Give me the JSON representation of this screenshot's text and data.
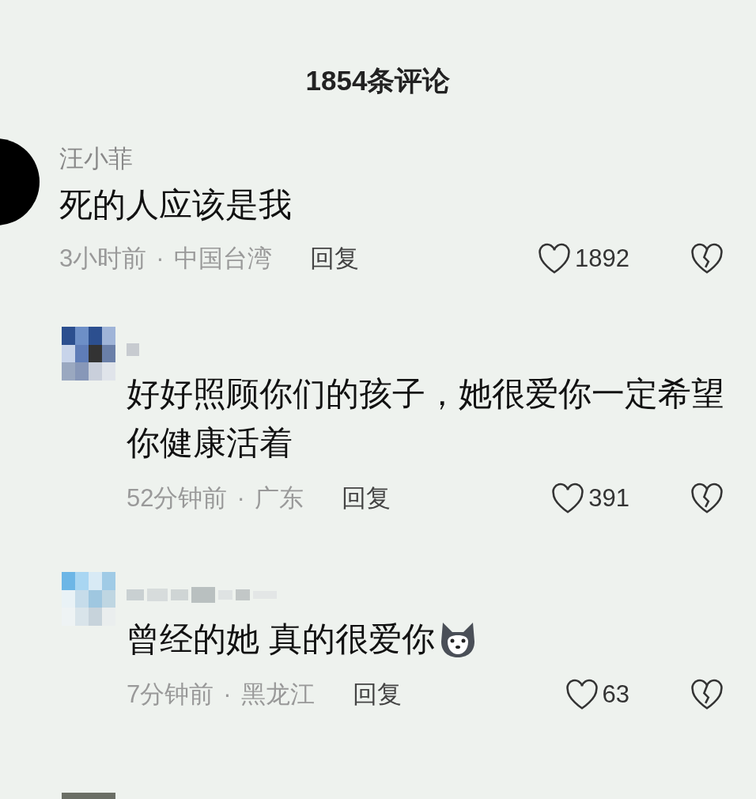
{
  "title": "1854条评论",
  "comments": [
    {
      "kind": "top",
      "name": "汪小菲",
      "text": "死的人应该是我",
      "emoji": false,
      "time": "3小时前",
      "separator": "·",
      "location": "中国台湾",
      "reply": "回复",
      "likes": "1892"
    },
    {
      "kind": "reply",
      "text": "好好照顾你们的孩子，她很爱你一定希望你健康活着",
      "emoji": false,
      "time": "52分钟前",
      "separator": "·",
      "location": "广东",
      "reply": "回复",
      "likes": "391"
    },
    {
      "kind": "reply",
      "text": "曾经的她 真的很爱你",
      "emoji": true,
      "time": "7分钟前",
      "separator": "·",
      "location": "黑龙江",
      "reply": "回复",
      "likes": "63"
    }
  ]
}
